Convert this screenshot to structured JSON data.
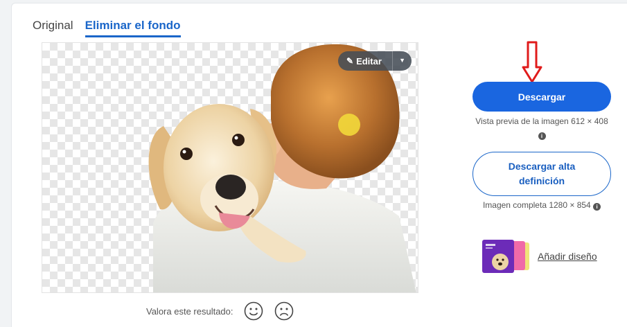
{
  "tabs": [
    {
      "label": "Original",
      "active": false
    },
    {
      "label": "Eliminar el fondo",
      "active": true
    }
  ],
  "preview": {
    "edit_button": {
      "label": "Editar",
      "icon": "pencil-icon"
    },
    "dropdown_icon": "caret-down-icon",
    "background_pattern": "transparency-checkerboard"
  },
  "rating": {
    "label": "Valora este resultado:",
    "positive_icon": "smile-icon",
    "negative_icon": "frown-icon"
  },
  "download": {
    "primary_label": "Descargar",
    "preview_note": "Vista previa de la imagen 612 × 408",
    "hd_label": "Descargar alta definición",
    "hd_note": "Imagen completa 1280 × 854"
  },
  "add_design": {
    "label": "Añadir diseño"
  },
  "annotation": {
    "arrow_color": "#e01b1b"
  },
  "colors": {
    "accent": "#1a66e0",
    "link": "#1a66c9"
  }
}
